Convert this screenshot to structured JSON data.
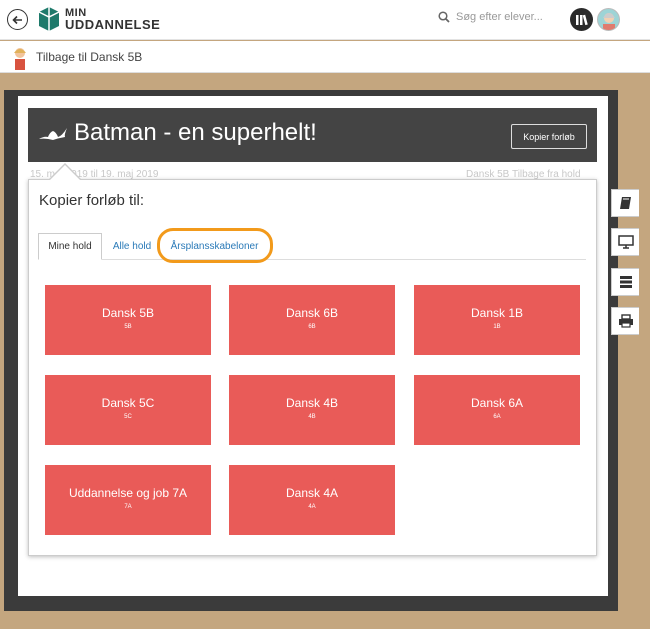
{
  "header": {
    "logo_line1": "MIN",
    "logo_line2": "UDDANNELSE",
    "search_placeholder": "Søg efter elever..."
  },
  "subbar": {
    "back_label": "Tilbage til Dansk 5B"
  },
  "course": {
    "title": "Batman - en superhelt!",
    "copy_button": "Kopier forløb",
    "date_range": "15. maj 2019 til 19. maj 2019",
    "right_text": "Dansk 5B Tilbage fra hold"
  },
  "popup": {
    "title": "Kopier forløb til:",
    "tabs": [
      {
        "label": "Mine hold"
      },
      {
        "label": "Alle hold"
      },
      {
        "label": "Årsplansskabeloner"
      }
    ],
    "cards": [
      {
        "name": "Dansk 5B",
        "code": "5B"
      },
      {
        "name": "Dansk 6B",
        "code": "6B"
      },
      {
        "name": "Dansk 1B",
        "code": "1B"
      },
      {
        "name": "Dansk 5C",
        "code": "5C"
      },
      {
        "name": "Dansk 4B",
        "code": "4B"
      },
      {
        "name": "Dansk 6A",
        "code": "6A"
      },
      {
        "name": "Uddannelse og job 7A",
        "code": "7A"
      },
      {
        "name": "Dansk 4A",
        "code": "4A"
      }
    ]
  },
  "colors": {
    "card": "#e95b58",
    "highlight": "#f29a1b",
    "link": "#2a7ab8",
    "hero": "#444444"
  },
  "icons": [
    "back-arrow-icon",
    "logo-icon",
    "search-icon",
    "library-icon",
    "user-avatar-icon",
    "book-icon",
    "monitor-icon",
    "list-icon",
    "print-icon",
    "bat-icon"
  ]
}
